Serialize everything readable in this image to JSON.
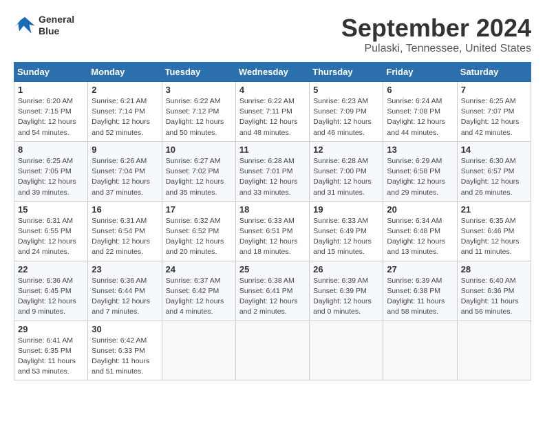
{
  "logo": {
    "line1": "General",
    "line2": "Blue"
  },
  "title": "September 2024",
  "location": "Pulaski, Tennessee, United States",
  "weekdays": [
    "Sunday",
    "Monday",
    "Tuesday",
    "Wednesday",
    "Thursday",
    "Friday",
    "Saturday"
  ],
  "weeks": [
    [
      {
        "day": "1",
        "info": "Sunrise: 6:20 AM\nSunset: 7:15 PM\nDaylight: 12 hours\nand 54 minutes."
      },
      {
        "day": "2",
        "info": "Sunrise: 6:21 AM\nSunset: 7:14 PM\nDaylight: 12 hours\nand 52 minutes."
      },
      {
        "day": "3",
        "info": "Sunrise: 6:22 AM\nSunset: 7:12 PM\nDaylight: 12 hours\nand 50 minutes."
      },
      {
        "day": "4",
        "info": "Sunrise: 6:22 AM\nSunset: 7:11 PM\nDaylight: 12 hours\nand 48 minutes."
      },
      {
        "day": "5",
        "info": "Sunrise: 6:23 AM\nSunset: 7:09 PM\nDaylight: 12 hours\nand 46 minutes."
      },
      {
        "day": "6",
        "info": "Sunrise: 6:24 AM\nSunset: 7:08 PM\nDaylight: 12 hours\nand 44 minutes."
      },
      {
        "day": "7",
        "info": "Sunrise: 6:25 AM\nSunset: 7:07 PM\nDaylight: 12 hours\nand 42 minutes."
      }
    ],
    [
      {
        "day": "8",
        "info": "Sunrise: 6:25 AM\nSunset: 7:05 PM\nDaylight: 12 hours\nand 39 minutes."
      },
      {
        "day": "9",
        "info": "Sunrise: 6:26 AM\nSunset: 7:04 PM\nDaylight: 12 hours\nand 37 minutes."
      },
      {
        "day": "10",
        "info": "Sunrise: 6:27 AM\nSunset: 7:02 PM\nDaylight: 12 hours\nand 35 minutes."
      },
      {
        "day": "11",
        "info": "Sunrise: 6:28 AM\nSunset: 7:01 PM\nDaylight: 12 hours\nand 33 minutes."
      },
      {
        "day": "12",
        "info": "Sunrise: 6:28 AM\nSunset: 7:00 PM\nDaylight: 12 hours\nand 31 minutes."
      },
      {
        "day": "13",
        "info": "Sunrise: 6:29 AM\nSunset: 6:58 PM\nDaylight: 12 hours\nand 29 minutes."
      },
      {
        "day": "14",
        "info": "Sunrise: 6:30 AM\nSunset: 6:57 PM\nDaylight: 12 hours\nand 26 minutes."
      }
    ],
    [
      {
        "day": "15",
        "info": "Sunrise: 6:31 AM\nSunset: 6:55 PM\nDaylight: 12 hours\nand 24 minutes."
      },
      {
        "day": "16",
        "info": "Sunrise: 6:31 AM\nSunset: 6:54 PM\nDaylight: 12 hours\nand 22 minutes."
      },
      {
        "day": "17",
        "info": "Sunrise: 6:32 AM\nSunset: 6:52 PM\nDaylight: 12 hours\nand 20 minutes."
      },
      {
        "day": "18",
        "info": "Sunrise: 6:33 AM\nSunset: 6:51 PM\nDaylight: 12 hours\nand 18 minutes."
      },
      {
        "day": "19",
        "info": "Sunrise: 6:33 AM\nSunset: 6:49 PM\nDaylight: 12 hours\nand 15 minutes."
      },
      {
        "day": "20",
        "info": "Sunrise: 6:34 AM\nSunset: 6:48 PM\nDaylight: 12 hours\nand 13 minutes."
      },
      {
        "day": "21",
        "info": "Sunrise: 6:35 AM\nSunset: 6:46 PM\nDaylight: 12 hours\nand 11 minutes."
      }
    ],
    [
      {
        "day": "22",
        "info": "Sunrise: 6:36 AM\nSunset: 6:45 PM\nDaylight: 12 hours\nand 9 minutes."
      },
      {
        "day": "23",
        "info": "Sunrise: 6:36 AM\nSunset: 6:44 PM\nDaylight: 12 hours\nand 7 minutes."
      },
      {
        "day": "24",
        "info": "Sunrise: 6:37 AM\nSunset: 6:42 PM\nDaylight: 12 hours\nand 4 minutes."
      },
      {
        "day": "25",
        "info": "Sunrise: 6:38 AM\nSunset: 6:41 PM\nDaylight: 12 hours\nand 2 minutes."
      },
      {
        "day": "26",
        "info": "Sunrise: 6:39 AM\nSunset: 6:39 PM\nDaylight: 12 hours\nand 0 minutes."
      },
      {
        "day": "27",
        "info": "Sunrise: 6:39 AM\nSunset: 6:38 PM\nDaylight: 11 hours\nand 58 minutes."
      },
      {
        "day": "28",
        "info": "Sunrise: 6:40 AM\nSunset: 6:36 PM\nDaylight: 11 hours\nand 56 minutes."
      }
    ],
    [
      {
        "day": "29",
        "info": "Sunrise: 6:41 AM\nSunset: 6:35 PM\nDaylight: 11 hours\nand 53 minutes."
      },
      {
        "day": "30",
        "info": "Sunrise: 6:42 AM\nSunset: 6:33 PM\nDaylight: 11 hours\nand 51 minutes."
      },
      {
        "day": "",
        "info": ""
      },
      {
        "day": "",
        "info": ""
      },
      {
        "day": "",
        "info": ""
      },
      {
        "day": "",
        "info": ""
      },
      {
        "day": "",
        "info": ""
      }
    ]
  ]
}
